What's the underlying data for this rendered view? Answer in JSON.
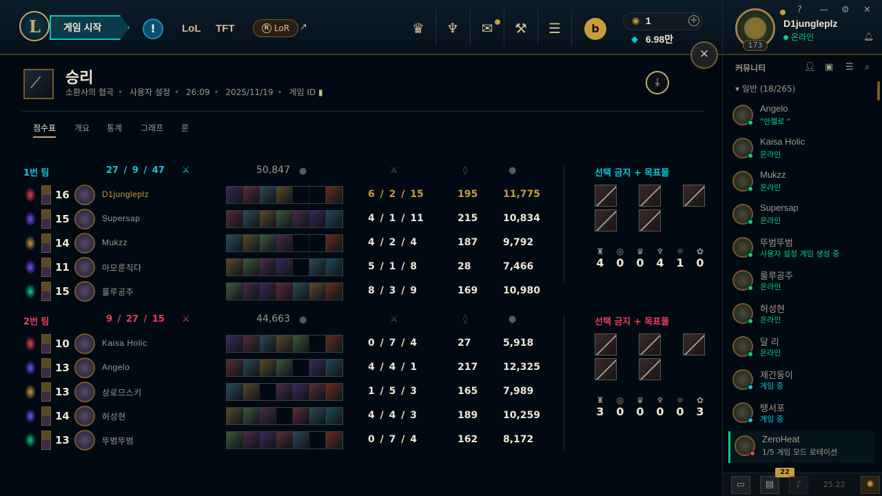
{
  "topbar": {
    "logo_glyph": "L",
    "play_label": "게임 시작",
    "alert_glyph": "!",
    "tabs": [
      "LoL",
      "TFT"
    ],
    "lor_label": "LoR",
    "lor_glyph": "R",
    "external_glyph": "↗",
    "icons": [
      "worlds-icon",
      "ranked-icon",
      "loot-icon",
      "crafting-icon",
      "store-coins-icon"
    ],
    "store_glyph": "b",
    "currency": {
      "rp": "1",
      "be": "6.98만",
      "add_glyph": "+"
    }
  },
  "profile": {
    "name": "D1jungleplz",
    "status": "온라인",
    "level": "173",
    "controls": [
      "?",
      "—",
      "⚙",
      "✕"
    ]
  },
  "close_glyph": "✕",
  "match": {
    "result": "승리",
    "mode": "소환사의 협곡",
    "type": "사용자 설정",
    "duration": "26:09",
    "date": "2025/11/19",
    "game_id_label": "게임 ID",
    "download_glyph": "⤓",
    "tabs": [
      "점수표",
      "개요",
      "통계",
      "그래프",
      "룬"
    ]
  },
  "teams": [
    {
      "name": "1번 팀",
      "kda": "27 / 9 / 47",
      "gold": "50,847",
      "bans_title": "선택 금지 + 목표물",
      "objectives": [
        "4",
        "0",
        "0",
        "4",
        "1",
        "0"
      ],
      "players": [
        {
          "lvl": "16",
          "name": "D1jungleplz",
          "kda": "6 / 2 / 15",
          "cs": "195",
          "gold": "11,775",
          "items": [
            1,
            1,
            1,
            1,
            0,
            0
          ],
          "me": true
        },
        {
          "lvl": "15",
          "name": "Supersap",
          "kda": "4 / 1 / 11",
          "cs": "215",
          "gold": "10,834",
          "items": [
            1,
            1,
            1,
            1,
            1,
            1
          ]
        },
        {
          "lvl": "14",
          "name": "Mukzz",
          "kda": "4 / 2 / 4",
          "cs": "187",
          "gold": "9,792",
          "items": [
            1,
            1,
            1,
            1,
            0,
            0
          ]
        },
        {
          "lvl": "11",
          "name": "아모룬직다",
          "kda": "5 / 1 / 8",
          "cs": "28",
          "gold": "7,466",
          "items": [
            1,
            1,
            1,
            1,
            0,
            1
          ]
        },
        {
          "lvl": "15",
          "name": "룰루공주",
          "kda": "8 / 3 / 9",
          "cs": "169",
          "gold": "10,980",
          "items": [
            1,
            1,
            1,
            1,
            1,
            1
          ]
        }
      ]
    },
    {
      "name": "2번 팀",
      "kda": "9 / 27 / 15",
      "gold": "44,663",
      "bans_title": "선택 금지 + 목표물",
      "objectives": [
        "3",
        "0",
        "0",
        "0",
        "0",
        "3"
      ],
      "players": [
        {
          "lvl": "10",
          "name": "Kaisa Holic",
          "kda": "0 / 7 / 4",
          "cs": "27",
          "gold": "5,918",
          "items": [
            1,
            1,
            1,
            1,
            1,
            0
          ]
        },
        {
          "lvl": "13",
          "name": "Angelo",
          "kda": "4 / 4 / 1",
          "cs": "217",
          "gold": "12,325",
          "items": [
            1,
            1,
            1,
            1,
            0,
            1
          ]
        },
        {
          "lvl": "13",
          "name": "상로므스키",
          "kda": "1 / 5 / 3",
          "cs": "165",
          "gold": "7,989",
          "items": [
            1,
            1,
            0,
            1,
            1,
            1
          ]
        },
        {
          "lvl": "14",
          "name": "허성현",
          "kda": "4 / 4 / 3",
          "cs": "189",
          "gold": "10,259",
          "items": [
            1,
            1,
            1,
            0,
            1,
            1
          ]
        },
        {
          "lvl": "13",
          "name": "뚜범뚜범",
          "kda": "0 / 7 / 4",
          "cs": "162",
          "gold": "8,172",
          "items": [
            1,
            1,
            1,
            1,
            1,
            0
          ]
        }
      ]
    }
  ],
  "community": {
    "title": "커뮤니티",
    "group": "일반 (18/265)",
    "friends": [
      {
        "name": "Angelo",
        "status": "\"안젤로 \"",
        "kind": "online"
      },
      {
        "name": "Kaisa Holic",
        "status": "온라인",
        "kind": "online"
      },
      {
        "name": "Mukzz",
        "status": "온라인",
        "kind": "online"
      },
      {
        "name": "Supersap",
        "status": "온라인",
        "kind": "online"
      },
      {
        "name": "뚜범뚜범",
        "status": "사용자 설정 게임 생성 중",
        "kind": "online"
      },
      {
        "name": "룰루공주",
        "status": "온라인",
        "kind": "online"
      },
      {
        "name": "허성현",
        "status": "온라인",
        "kind": "online"
      },
      {
        "name": "달 리",
        "status": "온라인",
        "kind": "online"
      },
      {
        "name": "제간둥이",
        "status": "게임 중",
        "kind": "ingame"
      },
      {
        "name": "탱서포",
        "status": "게임 중",
        "kind": "ingame"
      },
      {
        "name": "ZeroHeat",
        "status": "1/5 게임 모드 로테이션",
        "kind": "rotation"
      }
    ],
    "badge": "22",
    "version": "25.22"
  }
}
